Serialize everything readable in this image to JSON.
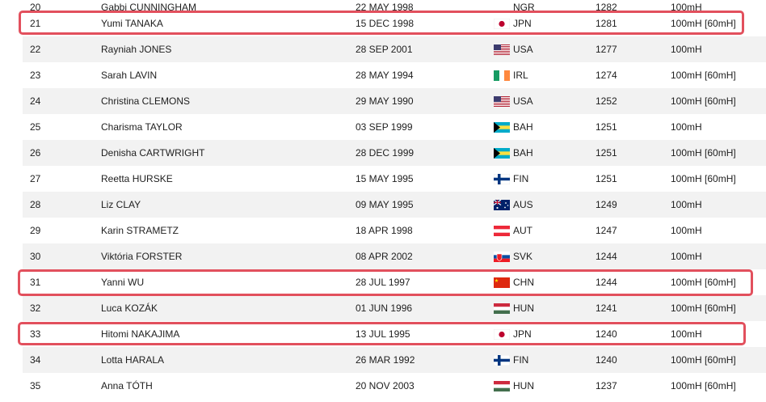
{
  "top_partial_row": {
    "rank": "20",
    "name": "Gabbi CUNNINGHAM",
    "dob": "22 MAY 1998",
    "nat": "NGR",
    "score": "1282",
    "event": "100mH"
  },
  "rows": [
    {
      "rank": "21",
      "name": "Yumi TANAKA",
      "dob": "15 DEC 1998",
      "flag": "jpn",
      "nat": "JPN",
      "score": "1281",
      "event": "100mH [60mH]"
    },
    {
      "rank": "22",
      "name": "Rayniah JONES",
      "dob": "28 SEP 2001",
      "flag": "usa",
      "nat": "USA",
      "score": "1277",
      "event": "100mH"
    },
    {
      "rank": "23",
      "name": "Sarah LAVIN",
      "dob": "28 MAY 1994",
      "flag": "irl",
      "nat": "IRL",
      "score": "1274",
      "event": "100mH [60mH]"
    },
    {
      "rank": "24",
      "name": "Christina CLEMONS",
      "dob": "29 MAY 1990",
      "flag": "usa",
      "nat": "USA",
      "score": "1252",
      "event": "100mH [60mH]"
    },
    {
      "rank": "25",
      "name": "Charisma TAYLOR",
      "dob": "03 SEP 1999",
      "flag": "bah",
      "nat": "BAH",
      "score": "1251",
      "event": "100mH"
    },
    {
      "rank": "26",
      "name": "Denisha CARTWRIGHT",
      "dob": "28 DEC 1999",
      "flag": "bah",
      "nat": "BAH",
      "score": "1251",
      "event": "100mH [60mH]"
    },
    {
      "rank": "27",
      "name": "Reetta HURSKE",
      "dob": "15 MAY 1995",
      "flag": "fin",
      "nat": "FIN",
      "score": "1251",
      "event": "100mH [60mH]"
    },
    {
      "rank": "28",
      "name": "Liz CLAY",
      "dob": "09 MAY 1995",
      "flag": "aus",
      "nat": "AUS",
      "score": "1249",
      "event": "100mH"
    },
    {
      "rank": "29",
      "name": "Karin STRAMETZ",
      "dob": "18 APR 1998",
      "flag": "aut",
      "nat": "AUT",
      "score": "1247",
      "event": "100mH"
    },
    {
      "rank": "30",
      "name": "Viktória FORSTER",
      "dob": "08 APR 2002",
      "flag": "svk",
      "nat": "SVK",
      "score": "1244",
      "event": "100mH"
    },
    {
      "rank": "31",
      "name": "Yanni WU",
      "dob": "28 JUL 1997",
      "flag": "chn",
      "nat": "CHN",
      "score": "1244",
      "event": "100mH [60mH]"
    },
    {
      "rank": "32",
      "name": "Luca KOZÁK",
      "dob": "01 JUN 1996",
      "flag": "hun",
      "nat": "HUN",
      "score": "1241",
      "event": "100mH [60mH]"
    },
    {
      "rank": "33",
      "name": "Hitomi NAKAJIMA",
      "dob": "13 JUL 1995",
      "flag": "jpn",
      "nat": "JPN",
      "score": "1240",
      "event": "100mH"
    },
    {
      "rank": "34",
      "name": "Lotta HARALA",
      "dob": "26 MAR 1992",
      "flag": "fin",
      "nat": "FIN",
      "score": "1240",
      "event": "100mH [60mH]"
    },
    {
      "rank": "35",
      "name": "Anna TÓTH",
      "dob": "20 NOV 2003",
      "flag": "hun",
      "nat": "HUN",
      "score": "1237",
      "event": "100mH [60mH]"
    }
  ],
  "highlighted_ranks": [
    "21",
    "31",
    "33"
  ],
  "colors": {
    "highlight": "#e2505d",
    "stripe": "#f2f2f2"
  }
}
